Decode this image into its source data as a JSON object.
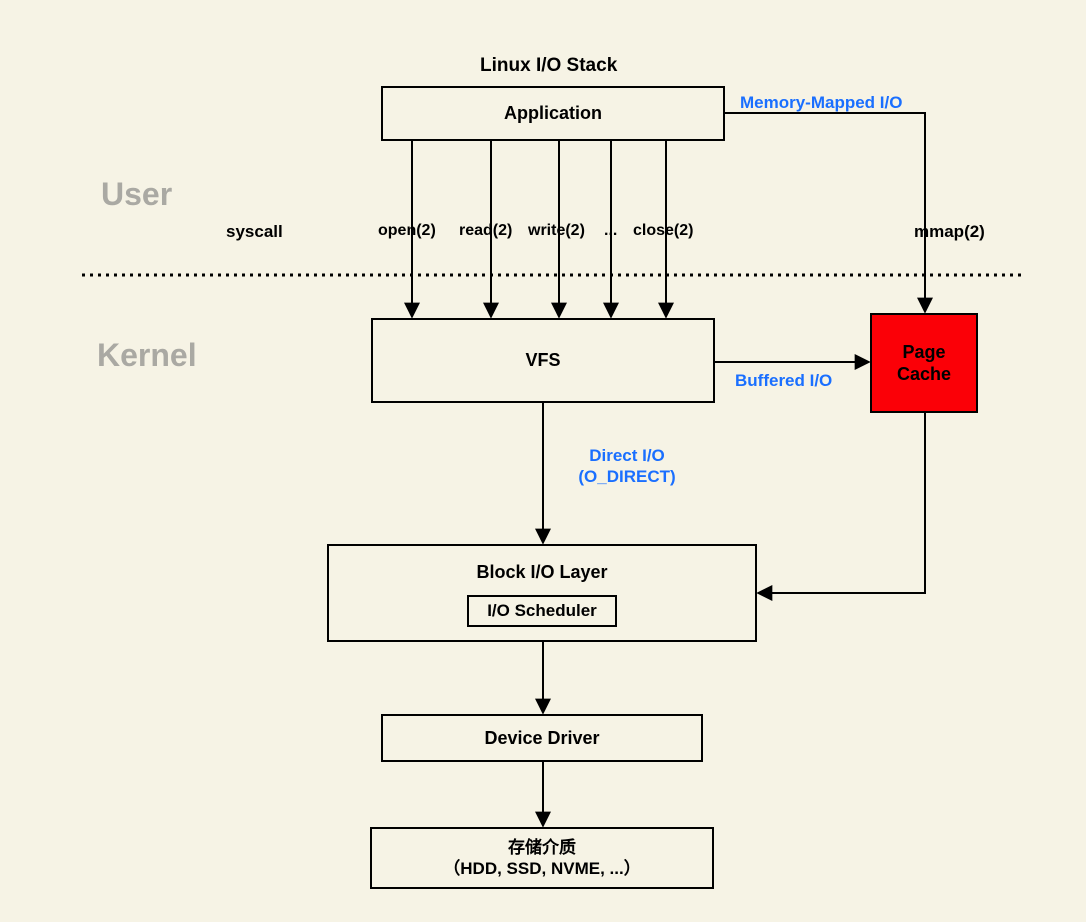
{
  "title": "Linux I/O Stack",
  "sections": {
    "user": "User",
    "kernel": "Kernel"
  },
  "boxes": {
    "application": "Application",
    "vfs": "VFS",
    "block_layer": "Block I/O Layer",
    "io_scheduler": "I/O Scheduler",
    "device_driver": "Device Driver",
    "storage_line1": "存储介质",
    "storage_line2": "（HDD, SSD, NVME, ...）",
    "page_cache_line1": "Page",
    "page_cache_line2": "Cache"
  },
  "labels": {
    "syscall": "syscall",
    "open": "open(2)",
    "read": "read(2)",
    "write": "write(2)",
    "dots": "...",
    "close": "close(2)",
    "mmap": "mmap(2)",
    "memory_mapped": "Memory-Mapped I/O",
    "buffered": "Buffered I/O",
    "direct_line1": "Direct I/O",
    "direct_line2": "(O_DIRECT)"
  },
  "colors": {
    "blue": "#1a6fff",
    "red": "#fb0007",
    "bg": "#f6f3e5"
  }
}
